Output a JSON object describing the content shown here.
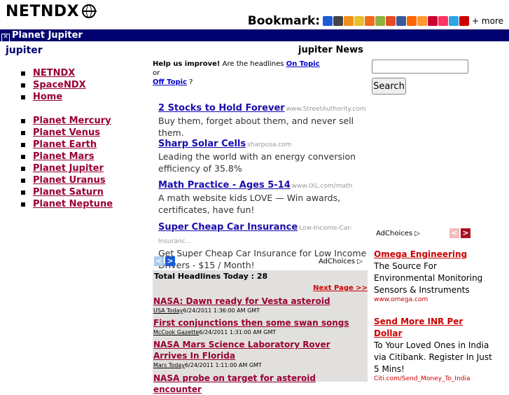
{
  "header": {
    "logo": "NETNDX",
    "bookmark_label": "Bookmark:",
    "more_label": "+ more",
    "bookmark_icon_colors": [
      "#1e5bd6",
      "#444444",
      "#ef8f1b",
      "#e6c12b",
      "#f26a1b",
      "#8fb13f",
      "#e34c26",
      "#3b5998",
      "#ff6600",
      "#ff9933",
      "#cc0033",
      "#ff3366",
      "#2ca5e0",
      "#cc0000"
    ]
  },
  "navbar": {
    "title": "Planet Jupiter"
  },
  "sidebar": {
    "title": "jupiter",
    "links_group1": [
      "NETNDX",
      "SpaceNDX",
      "Home"
    ],
    "links_group2": [
      "Planet Mercury",
      "Planet Venus",
      "Planet Earth",
      "Planet Mars",
      "Planet Jupiter",
      "Planet Uranus",
      "Planet Saturn",
      "Planet Neptune"
    ]
  },
  "main": {
    "title": "jupiter News",
    "improve": {
      "lead": "Help us improve!",
      "text1": " Are the headlines ",
      "on_topic": "On Topic",
      "text2": " or",
      "off_topic": "Off Topic",
      "text3": " ?"
    },
    "ads": [
      {
        "title": "2 Stocks to Hold Forever",
        "url": "www.StreetAuthority.com",
        "desc": "Buy them, forget about them, and never sell them."
      },
      {
        "title": "Sharp Solar Cells",
        "url": "sharpusa.com",
        "desc": "Leading the world with an energy conversion efficiency of 35.8%"
      },
      {
        "title": "Math Practice - Ages 5-14",
        "url": "www.IXL.com/math",
        "desc": "A math website kids LOVE — Win awards, certificates, have fun!"
      },
      {
        "title": "Super Cheap Car Insurance",
        "url": "Low-Income-Car-Insuranc...",
        "desc": "Get Super Cheap Car Insurance for Low Income Drivers - $15 / Month!"
      }
    ],
    "adchoices": "AdChoices ▷",
    "headlines": {
      "total": "Total Headlines Today : 28",
      "next_page": "Next Page >>",
      "items": [
        {
          "title": "NASA: Dawn ready for Vesta asteroid",
          "source": "USA Today",
          "time": "6/24/2011 1:36:00 AM GMT"
        },
        {
          "title": "First conjunctions then some swan songs",
          "source": "McCook Gazette",
          "time": "6/24/2011 1:31:00 AM GMT"
        },
        {
          "title": "NASA Mars Science Laboratory Rover Arrives In Florida",
          "source": "Mars Today",
          "time": "6/24/2011 1:11:00 AM GMT"
        },
        {
          "title": "NASA probe on target for asteroid encounter",
          "source": "",
          "time": ""
        }
      ]
    }
  },
  "search": {
    "button_label": "Search",
    "value": ""
  },
  "right_ads": {
    "adchoices": "AdChoices ▷",
    "items": [
      {
        "title": "Omega Engineering",
        "desc": "The Source For Environmental Monitoring Sensors & Instruments",
        "url": "www.omega.com"
      },
      {
        "title": "Send More INR Per Dollar",
        "desc": "To Your Loved Ones in India via Citibank. Register In Just 5 Mins!",
        "url": "Citi.com/Send_Money_To_India"
      }
    ]
  }
}
